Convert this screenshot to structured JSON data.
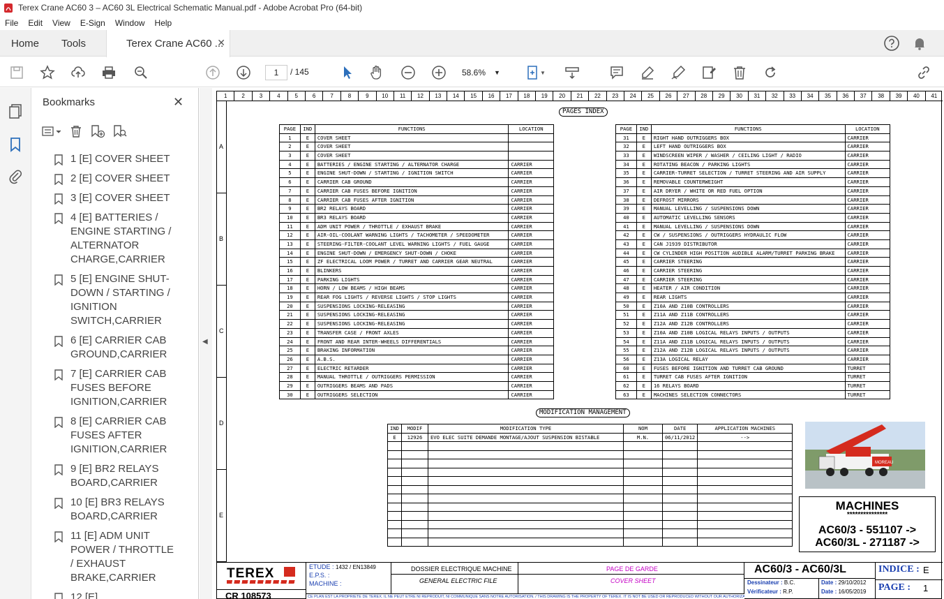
{
  "window": {
    "title": "Terex Crane AC60 3 – AC60 3L Electrical Schematic Manual.pdf - Adobe Acrobat Pro (64-bit)"
  },
  "menu": [
    "File",
    "Edit",
    "View",
    "E-Sign",
    "Window",
    "Help"
  ],
  "tabs": {
    "home": "Home",
    "tools": "Tools",
    "doc": "Terex Crane AC60 ..."
  },
  "toolbar": {
    "page_current": "1",
    "page_total": "/  145",
    "zoom": "58.6%"
  },
  "colors": {
    "accent": "#2c6fbb",
    "terex_red": "#d52b1e",
    "magenta": "#c400c4"
  },
  "bookmarks_panel": {
    "title": "Bookmarks",
    "items": [
      "1 [E] COVER SHEET",
      "2 [E] COVER SHEET",
      "3 [E] COVER SHEET",
      "4 [E] BATTERIES / ENGINE STARTING / ALTERNATOR CHARGE,CARRIER",
      "5 [E] ENGINE SHUT-DOWN / STARTING / IGNITION SWITCH,CARRIER",
      "6 [E] CARRIER CAB GROUND,CARRIER",
      "7 [E] CARRIER CAB FUSES BEFORE IGNITION,CARRIER",
      "8 [E] CARRIER CAB FUSES AFTER IGNITION,CARRIER",
      "9 [E] BR2 RELAYS BOARD,CARRIER",
      "10 [E] BR3 RELAYS BOARD,CARRIER",
      "11 [E] ADM UNIT POWER / THROTTLE / EXHAUST BRAKE,CARRIER",
      "12 [E]"
    ]
  },
  "sheet": {
    "col_numbers": [
      "1",
      "2",
      "3",
      "4",
      "5",
      "6",
      "7",
      "8",
      "9",
      "10",
      "11",
      "12",
      "13",
      "14",
      "15",
      "16",
      "17",
      "18",
      "19",
      "20",
      "21",
      "22",
      "23",
      "24",
      "25",
      "26",
      "27",
      "28",
      "29",
      "30",
      "31",
      "32",
      "33",
      "34",
      "35",
      "36",
      "37",
      "38",
      "39",
      "40",
      "41"
    ],
    "row_letters": [
      "A",
      "B",
      "C",
      "D",
      "E"
    ],
    "pages_index_title": "PAGES INDEX",
    "headers": {
      "page": "PAGE",
      "ind": "IND",
      "functions": "FUNCTIONS",
      "location": "LOCATION"
    },
    "left_index": [
      [
        "1",
        "E",
        "COVER SHEET",
        ""
      ],
      [
        "2",
        "E",
        "COVER SHEET",
        ""
      ],
      [
        "3",
        "E",
        "COVER SHEET",
        ""
      ],
      [
        "4",
        "E",
        "BATTERIES / ENGINE STARTING / ALTERNATOR CHARGE",
        "CARRIER"
      ],
      [
        "5",
        "E",
        "ENGINE SHUT-DOWN / STARTING / IGNITION SWITCH",
        "CARRIER"
      ],
      [
        "6",
        "E",
        "CARRIER CAB GROUND",
        "CARRIER"
      ],
      [
        "7",
        "E",
        "CARRIER CAB FUSES BEFORE IGNITION",
        "CARRIER"
      ],
      [
        "8",
        "E",
        "CARRIER CAB FUSES AFTER IGNITION",
        "CARRIER"
      ],
      [
        "9",
        "E",
        "BR2 RELAYS BOARD",
        "CARRIER"
      ],
      [
        "10",
        "E",
        "BR3 RELAYS BOARD",
        "CARRIER"
      ],
      [
        "11",
        "E",
        "ADM UNIT POWER / THROTTLE / EXHAUST BRAKE",
        "CARRIER"
      ],
      [
        "12",
        "E",
        "AIR-OIL-COOLANT WARNING LIGHTS / TACHOMETER / SPEEDOMETER",
        "CARRIER"
      ],
      [
        "13",
        "E",
        "STEERING-FILTER-COOLANT LEVEL WARNING LIGHTS / FUEL GAUGE",
        "CARRIER"
      ],
      [
        "14",
        "E",
        "ENGINE SHUT-DOWN / EMERGENCY SHUT-DOWN / CHOKE",
        "CARRIER"
      ],
      [
        "15",
        "E",
        "ZF ELECTRICAL LOOM POWER / TURRET AND CARRIER GEAR NEUTRAL",
        "CARRIER"
      ],
      [
        "16",
        "E",
        "BLINKERS",
        "CARRIER"
      ],
      [
        "17",
        "E",
        "PARKING LIGHTS",
        "CARRIER"
      ],
      [
        "18",
        "E",
        "HORN / LOW BEAMS / HIGH BEAMS",
        "CARRIER"
      ],
      [
        "19",
        "E",
        "REAR FOG LIGHTS / REVERSE LIGHTS / STOP LIGHTS",
        "CARRIER"
      ],
      [
        "20",
        "E",
        "SUSPENSIONS LOCKING-RELEASING",
        "CARRIER"
      ],
      [
        "21",
        "E",
        "SUSPENSIONS LOCKING-RELEASING",
        "CARRIER"
      ],
      [
        "22",
        "E",
        "SUSPENSIONS LOCKING-RELEASING",
        "CARRIER"
      ],
      [
        "23",
        "E",
        "TRANSFER CASE / FRONT AXLES",
        "CARRIER"
      ],
      [
        "24",
        "E",
        "FRONT AND REAR INTER-WHEELS DIFFERENTIALS",
        "CARRIER"
      ],
      [
        "25",
        "E",
        "BRAKING INFORMATION",
        "CARRIER"
      ],
      [
        "26",
        "E",
        "A.B.S.",
        "CARRIER"
      ],
      [
        "27",
        "E",
        "ELECTRIC RETARDER",
        "CARRIER"
      ],
      [
        "28",
        "E",
        "MANUAL THROTTLE / OUTRIGGERS PERMISSION",
        "CARRIER"
      ],
      [
        "29",
        "E",
        "OUTRIGGERS BEAMS AND PADS",
        "CARRIER"
      ],
      [
        "30",
        "E",
        "OUTRIGGERS SELECTION",
        "CARRIER"
      ]
    ],
    "right_index": [
      [
        "31",
        "E",
        "RIGHT HAND OUTRIGGERS BOX",
        "CARRIER"
      ],
      [
        "32",
        "E",
        "LEFT HAND OUTRIGGERS BOX",
        "CARRIER"
      ],
      [
        "33",
        "E",
        "WINDSCREEN WIPER / WASHER / CEILING LIGHT / RADIO",
        "CARRIER"
      ],
      [
        "34",
        "E",
        "ROTATING BEACON / PARKING LIGHTS",
        "CARRIER"
      ],
      [
        "35",
        "E",
        "CARRIER-TURRET SELECTION / TURRET STEERING AND AIR SUPPLY",
        "CARRIER"
      ],
      [
        "36",
        "E",
        "REMOVABLE COUNTERWEIGHT",
        "CARRIER"
      ],
      [
        "37",
        "E",
        "AIR DRYER / WHITE OR RED FUEL OPTION",
        "CARRIER"
      ],
      [
        "38",
        "E",
        "DEFROST MIRRORS",
        "CARRIER"
      ],
      [
        "39",
        "E",
        "MANUAL LEVELLING / SUSPENSIONS DOWN",
        "CARRIER"
      ],
      [
        "40",
        "E",
        "AUTOMATIC LEVELLING SENSORS",
        "CARRIER"
      ],
      [
        "41",
        "E",
        "MANUAL LEVELLING / SUSPENSIONS DOWN",
        "CARRIER"
      ],
      [
        "42",
        "E",
        "CW / SUSPENSIONS / OUTRIGGERS HYDRAULIC FLOW",
        "CARRIER"
      ],
      [
        "43",
        "E",
        "CAN J1939 DISTRIBUTOR",
        "CARRIER"
      ],
      [
        "44",
        "E",
        "CW CYLINDER HIGH POSITION AUDIBLE ALARM/TURRET PARKING BRAKE",
        "CARRIER"
      ],
      [
        "45",
        "E",
        "CARRIER STEERING",
        "CARRIER"
      ],
      [
        "46",
        "E",
        "CARRIER STEERING",
        "CARRIER"
      ],
      [
        "47",
        "E",
        "CARRIER STEERING",
        "CARRIER"
      ],
      [
        "48",
        "E",
        "HEATER / AIR CONDITION",
        "CARRIER"
      ],
      [
        "49",
        "E",
        "REAR LIGHTS",
        "CARRIER"
      ],
      [
        "50",
        "E",
        "Z10A AND Z10B CONTROLLERS",
        "CARRIER"
      ],
      [
        "51",
        "E",
        "Z11A AND Z11B CONTROLLERS",
        "CARRIER"
      ],
      [
        "52",
        "E",
        "Z12A AND Z12B CONTROLLERS",
        "CARRIER"
      ],
      [
        "53",
        "E",
        "Z10A AND Z10B LOGICAL RELAYS INPUTS / OUTPUTS",
        "CARRIER"
      ],
      [
        "54",
        "E",
        "Z11A AND Z11B LOGICAL RELAYS INPUTS / OUTPUTS",
        "CARRIER"
      ],
      [
        "55",
        "E",
        "Z12A AND Z12B LOGICAL RELAYS INPUTS / OUTPUTS",
        "CARRIER"
      ],
      [
        "56",
        "E",
        "Z13A LOGICAL RELAY",
        "CARRIER"
      ],
      [
        "60",
        "E",
        "FUSES BEFORE IGNITION AND TURRET CAB GROUND",
        "TURRET"
      ],
      [
        "61",
        "E",
        "TURRET CAB FUSES AFTER IGNITION",
        "TURRET"
      ],
      [
        "62",
        "E",
        "16 RELAYS BOARD",
        "TURRET"
      ],
      [
        "63",
        "E",
        "MACHINES SELECTION CONNECTORS",
        "TURRET"
      ]
    ],
    "mod_title": "MODIFICATION MANAGEMENT",
    "mod_headers": [
      "IND",
      "MODIF",
      "MODIFICATION TYPE",
      "NOM",
      "DATE",
      "APPLICATION MACHINES"
    ],
    "mod_rows": [
      [
        "E",
        "12926",
        "EVO ELEC SUITE DEMANDE MONTAGE/AJOUT SUSPENSION BISTABLE",
        "M.N.",
        "06/11/2012",
        "-->"
      ]
    ],
    "machines": {
      "title": "MACHINES",
      "stars": "***************",
      "line1": "AC60/3 - 551107 ->",
      "line2": "AC60/3L - 271187 ->"
    },
    "titleblock": {
      "logo": "TEREX",
      "cr": "CR 108573",
      "etude": "ETUDE :",
      "etude_val": "1432 / EN13849",
      "eps": "E.P.S. :",
      "machine": "MACHINE :",
      "dossier": "DOSSIER ELECTRIQUE MACHINE",
      "general": "GENERAL ELECTRIC FILE",
      "page_garde": "PAGE DE GARDE",
      "cover": "COVER SHEET",
      "model": "AC60/3 - AC60/3L",
      "indice_label": "INDICE :",
      "indice_val": "E",
      "page_label": "PAGE :",
      "page_val": "1",
      "dessinateur": "Dessinateur :",
      "dessinateur_val": "B.C.",
      "verificateur": "Vérificateur :",
      "verificateur_val": "R.P.",
      "date_label": "Date :",
      "date1": "29/10/2012",
      "date2": "16/05/2019",
      "notice": "CE PLAN EST LA PROPRIETE DE TEREX. IL NE PEUT ETRE NI REPRODUIT, NI COMMUNIQUE SANS NOTRE AUTORISATION. / THIS DRAWING IS THE PROPERTY OF TEREX. IT IS NOT BE USED OR REPRODUCED WITHOUT OUR AUTHORIZATION."
    }
  }
}
